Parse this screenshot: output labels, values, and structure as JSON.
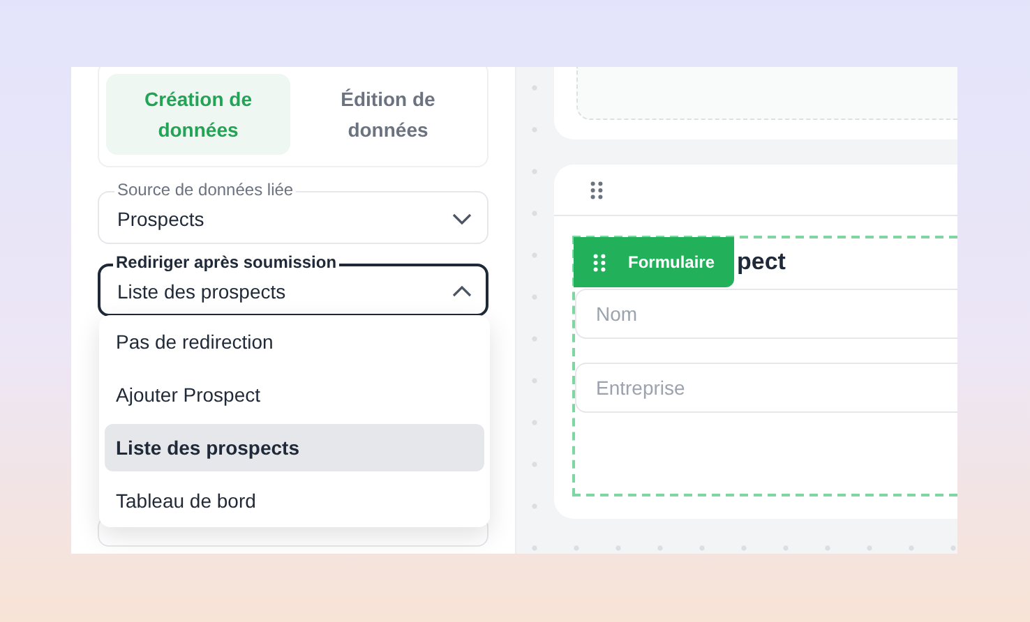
{
  "mode_tabs": [
    {
      "label": "Création de données",
      "selected": true
    },
    {
      "label": "Édition de données",
      "selected": false
    }
  ],
  "source_field": {
    "label": "Source de données liée",
    "value": "Prospects",
    "open": false
  },
  "redirect_field": {
    "label": "Rediriger après soumission",
    "value": "Liste des prospects",
    "open": true
  },
  "redirect_options": [
    {
      "label": "Pas de redirection",
      "selected": false
    },
    {
      "label": "Ajouter Prospect",
      "selected": false
    },
    {
      "label": "Liste des prospects",
      "selected": true
    },
    {
      "label": "Tableau de bord",
      "selected": false
    }
  ],
  "form_block": {
    "badge": "Formulaire",
    "title": "pect",
    "fields": [
      {
        "placeholder": "Nom"
      },
      {
        "placeholder": "Entreprise"
      }
    ]
  }
}
